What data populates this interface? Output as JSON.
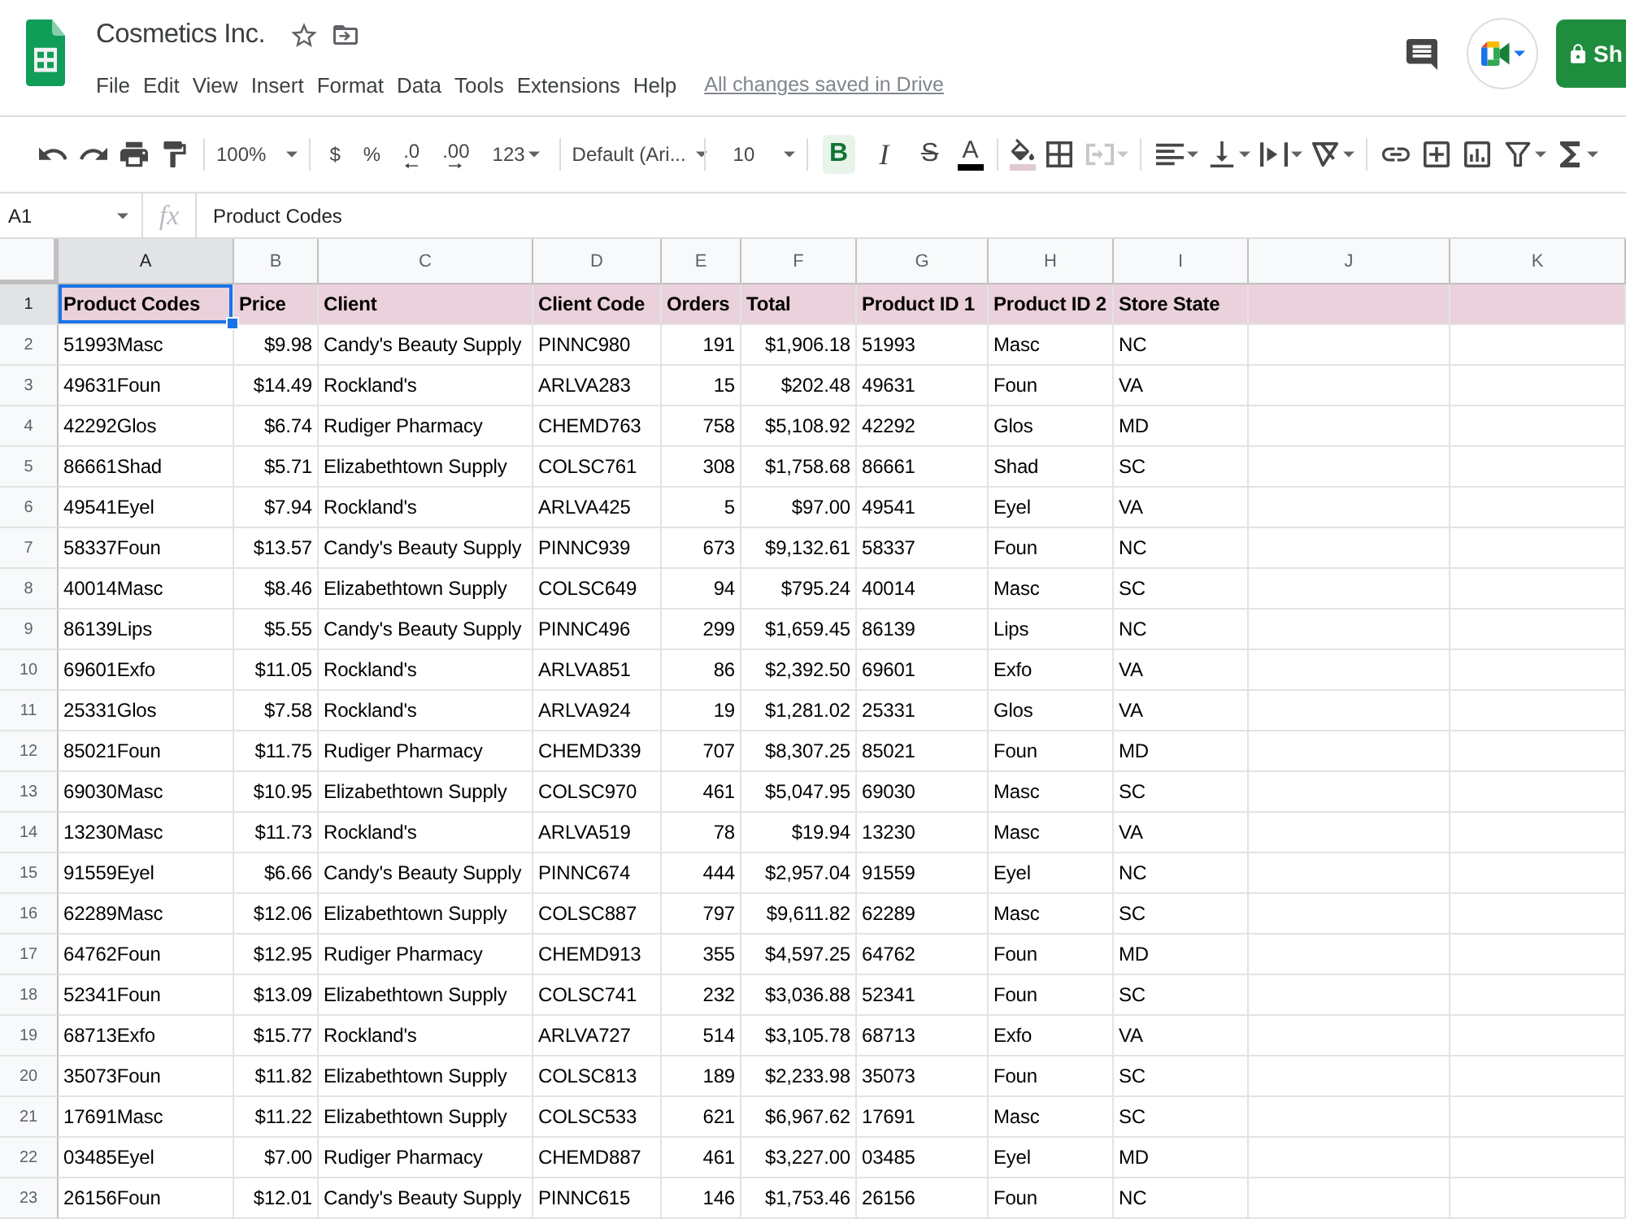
{
  "document": {
    "title": "Cosmetics Inc.",
    "starred": false
  },
  "menu": [
    "File",
    "Edit",
    "View",
    "Insert",
    "Format",
    "Data",
    "Tools",
    "Extensions",
    "Help"
  ],
  "save_status": "All changes saved in Drive",
  "share_button": {
    "label": "Sh"
  },
  "toolbar": {
    "zoom": "100%",
    "number_formats": [
      {
        "label": "$",
        "kind": "currency"
      },
      {
        "label": "%",
        "kind": "percent"
      },
      {
        "label": ".0",
        "kind": "decrease_decimals"
      },
      {
        "label": ".00",
        "kind": "increase_decimals"
      },
      {
        "label": "123",
        "kind": "more_formats"
      }
    ],
    "font": "Default (Ari...",
    "font_size": "10",
    "text_styles": [
      {
        "label": "B",
        "kind": "bold",
        "on": true
      },
      {
        "label": "I",
        "kind": "italic",
        "on": false
      },
      {
        "label": "S",
        "kind": "strikethrough",
        "on": false
      }
    ],
    "text_color": {
      "label": "A",
      "color": "#000000"
    },
    "fill_color": {
      "color": "#dfc9d5"
    },
    "merge_disabled": true
  },
  "formula_bar": {
    "cell_reference": "A1",
    "function_label": "fx",
    "value": "Product Codes"
  },
  "sheet": {
    "columns": [
      {
        "label": "A",
        "selected": true
      },
      {
        "label": "B",
        "selected": false
      },
      {
        "label": "C",
        "selected": false
      },
      {
        "label": "D",
        "selected": false
      },
      {
        "label": "E",
        "selected": false
      },
      {
        "label": "F",
        "selected": false
      },
      {
        "label": "G",
        "selected": false
      },
      {
        "label": "H",
        "selected": false
      },
      {
        "label": "I",
        "selected": false
      },
      {
        "label": "J",
        "selected": false
      },
      {
        "label": "K",
        "selected": false
      }
    ],
    "header_row": {
      "number": "1",
      "selected": true,
      "cells": [
        "Product Codes",
        "Price",
        "Client",
        "Client Code",
        "Orders",
        "Total",
        "Product ID 1",
        "Product ID 2",
        "Store State"
      ]
    },
    "rows": [
      {
        "number": "2",
        "selected": false,
        "cells": [
          "51993Masc",
          "$9.98",
          "Candy's Beauty Supply",
          "PINNC980",
          "191",
          "$1,906.18",
          "51993",
          "Masc",
          "NC"
        ]
      },
      {
        "number": "3",
        "selected": false,
        "cells": [
          "49631Foun",
          "$14.49",
          "Rockland's",
          "ARLVA283",
          "15",
          "$202.48",
          "49631",
          "Foun",
          "VA"
        ]
      },
      {
        "number": "4",
        "selected": false,
        "cells": [
          "42292Glos",
          "$6.74",
          "Rudiger Pharmacy",
          "CHEMD763",
          "758",
          "$5,108.92",
          "42292",
          "Glos",
          "MD"
        ]
      },
      {
        "number": "5",
        "selected": false,
        "cells": [
          "86661Shad",
          "$5.71",
          "Elizabethtown Supply",
          "COLSC761",
          "308",
          "$1,758.68",
          "86661",
          "Shad",
          "SC"
        ]
      },
      {
        "number": "6",
        "selected": false,
        "cells": [
          "49541Eyel",
          "$7.94",
          "Rockland's",
          "ARLVA425",
          "5",
          "$97.00",
          "49541",
          "Eyel",
          "VA"
        ]
      },
      {
        "number": "7",
        "selected": false,
        "cells": [
          "58337Foun",
          "$13.57",
          "Candy's Beauty Supply",
          "PINNC939",
          "673",
          "$9,132.61",
          "58337",
          "Foun",
          "NC"
        ]
      },
      {
        "number": "8",
        "selected": false,
        "cells": [
          "40014Masc",
          "$8.46",
          "Elizabethtown Supply",
          "COLSC649",
          "94",
          "$795.24",
          "40014",
          "Masc",
          "SC"
        ]
      },
      {
        "number": "9",
        "selected": false,
        "cells": [
          "86139Lips",
          "$5.55",
          "Candy's Beauty Supply",
          "PINNC496",
          "299",
          "$1,659.45",
          "86139",
          "Lips",
          "NC"
        ]
      },
      {
        "number": "10",
        "selected": false,
        "cells": [
          "69601Exfo",
          "$11.05",
          "Rockland's",
          "ARLVA851",
          "86",
          "$2,392.50",
          "69601",
          "Exfo",
          "VA"
        ]
      },
      {
        "number": "11",
        "selected": false,
        "cells": [
          "25331Glos",
          "$7.58",
          "Rockland's",
          "ARLVA924",
          "19",
          "$1,281.02",
          "25331",
          "Glos",
          "VA"
        ]
      },
      {
        "number": "12",
        "selected": false,
        "cells": [
          "85021Foun",
          "$11.75",
          "Rudiger Pharmacy",
          "CHEMD339",
          "707",
          "$8,307.25",
          "85021",
          "Foun",
          "MD"
        ]
      },
      {
        "number": "13",
        "selected": false,
        "cells": [
          "69030Masc",
          "$10.95",
          "Elizabethtown Supply",
          "COLSC970",
          "461",
          "$5,047.95",
          "69030",
          "Masc",
          "SC"
        ]
      },
      {
        "number": "14",
        "selected": false,
        "cells": [
          "13230Masc",
          "$11.73",
          "Rockland's",
          "ARLVA519",
          "78",
          "$19.94",
          "13230",
          "Masc",
          "VA"
        ]
      },
      {
        "number": "15",
        "selected": false,
        "cells": [
          "91559Eyel",
          "$6.66",
          "Candy's Beauty Supply",
          "PINNC674",
          "444",
          "$2,957.04",
          "91559",
          "Eyel",
          "NC"
        ]
      },
      {
        "number": "16",
        "selected": false,
        "cells": [
          "62289Masc",
          "$12.06",
          "Elizabethtown Supply",
          "COLSC887",
          "797",
          "$9,611.82",
          "62289",
          "Masc",
          "SC"
        ]
      },
      {
        "number": "17",
        "selected": false,
        "cells": [
          "64762Foun",
          "$12.95",
          "Rudiger Pharmacy",
          "CHEMD913",
          "355",
          "$4,597.25",
          "64762",
          "Foun",
          "MD"
        ]
      },
      {
        "number": "18",
        "selected": false,
        "cells": [
          "52341Foun",
          "$13.09",
          "Elizabethtown Supply",
          "COLSC741",
          "232",
          "$3,036.88",
          "52341",
          "Foun",
          "SC"
        ]
      },
      {
        "number": "19",
        "selected": false,
        "cells": [
          "68713Exfo",
          "$15.77",
          "Rockland's",
          "ARLVA727",
          "514",
          "$3,105.78",
          "68713",
          "Exfo",
          "VA"
        ]
      },
      {
        "number": "20",
        "selected": false,
        "cells": [
          "35073Foun",
          "$11.82",
          "Elizabethtown Supply",
          "COLSC813",
          "189",
          "$2,233.98",
          "35073",
          "Foun",
          "SC"
        ]
      },
      {
        "number": "21",
        "selected": false,
        "cells": [
          "17691Masc",
          "$11.22",
          "Elizabethtown Supply",
          "COLSC533",
          "621",
          "$6,967.62",
          "17691",
          "Masc",
          "SC"
        ]
      },
      {
        "number": "22",
        "selected": false,
        "cells": [
          "03485Eyel",
          "$7.00",
          "Rudiger Pharmacy",
          "CHEMD887",
          "461",
          "$3,227.00",
          "03485",
          "Eyel",
          "MD"
        ]
      },
      {
        "number": "23",
        "selected": false,
        "cells": [
          "26156Foun",
          "$12.01",
          "Candy's Beauty Supply",
          "PINNC615",
          "146",
          "$1,753.46",
          "26156",
          "Foun",
          "NC"
        ]
      }
    ]
  }
}
